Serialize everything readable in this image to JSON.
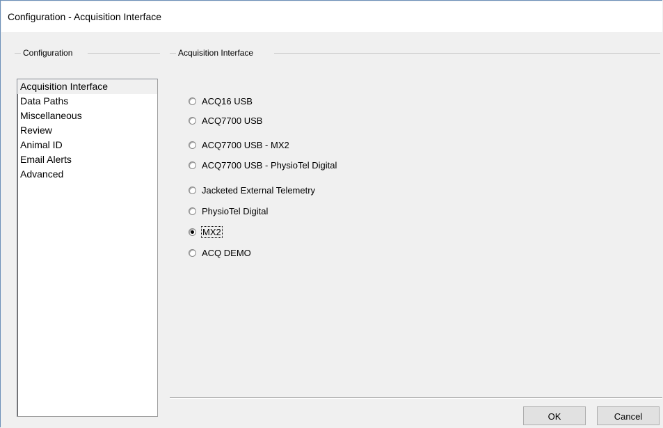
{
  "window": {
    "title": "Configuration - Acquisition Interface"
  },
  "configuration_group": {
    "label": "Configuration",
    "items": [
      {
        "label": "Acquisition Interface",
        "selected": true
      },
      {
        "label": "Data Paths"
      },
      {
        "label": "Miscellaneous"
      },
      {
        "label": "Review"
      },
      {
        "label": "Animal ID"
      },
      {
        "label": "Email Alerts"
      },
      {
        "label": "Advanced"
      }
    ]
  },
  "acquisition_group": {
    "label": "Acquisition Interface",
    "options": [
      {
        "label": "ACQ16 USB",
        "checked": false
      },
      {
        "label": "ACQ7700 USB",
        "checked": false
      },
      {
        "label": "ACQ7700 USB - MX2",
        "checked": false
      },
      {
        "label": "ACQ7700 USB - PhysioTel Digital",
        "checked": false
      },
      {
        "label": "Jacketed External Telemetry",
        "checked": false
      },
      {
        "label": "PhysioTel Digital",
        "checked": false
      },
      {
        "label": "MX2",
        "checked": true
      },
      {
        "label": "ACQ DEMO",
        "checked": false
      }
    ]
  },
  "buttons": {
    "ok": "OK",
    "cancel": "Cancel"
  }
}
